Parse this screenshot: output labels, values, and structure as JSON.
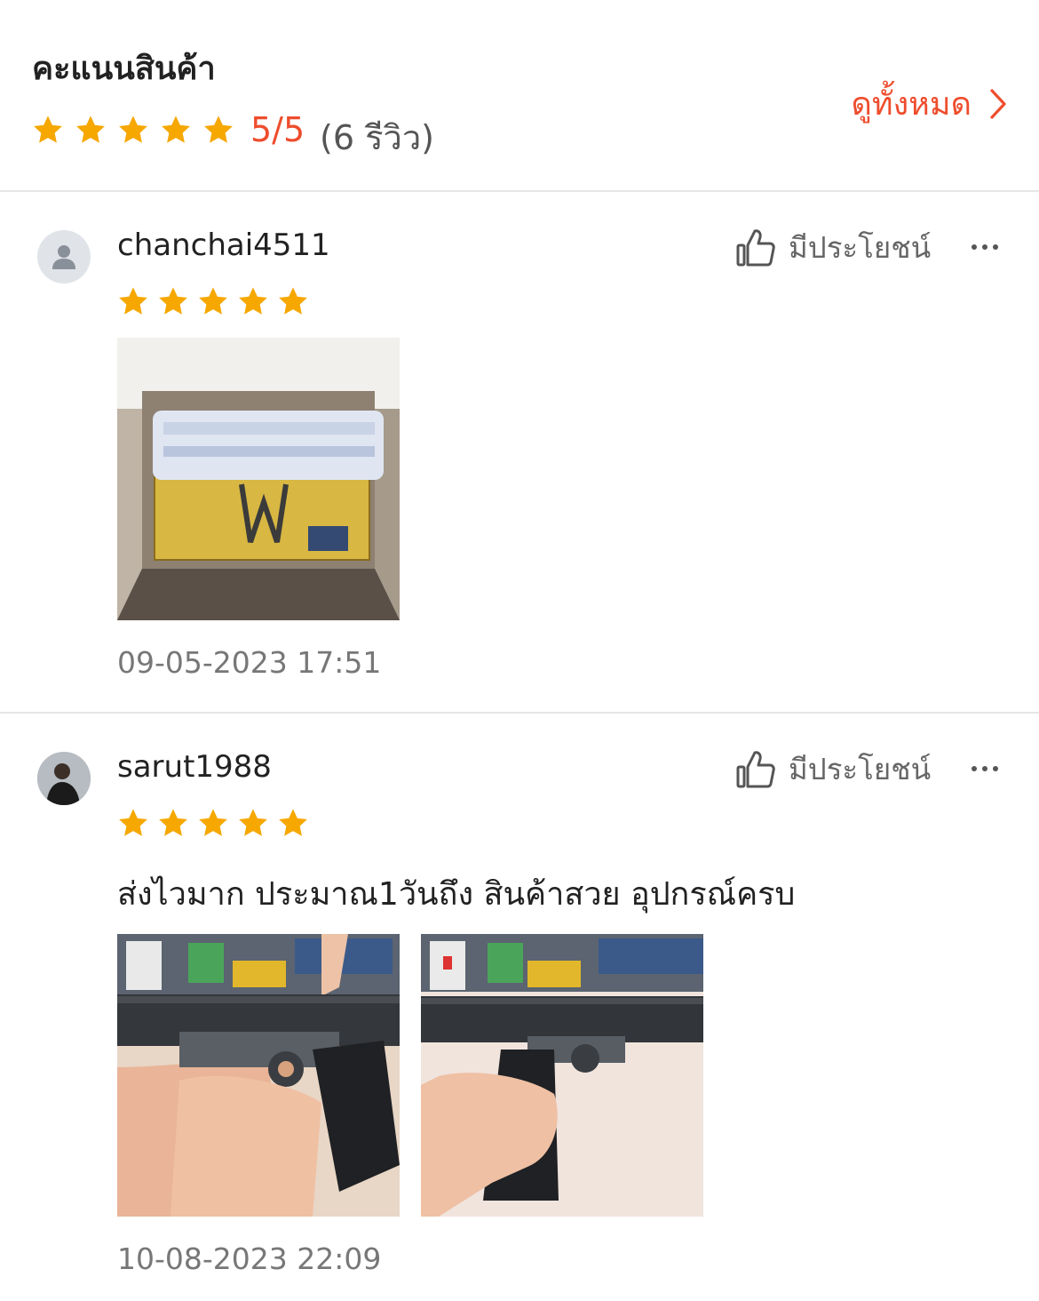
{
  "summary": {
    "title": "คะแนนสินค้า",
    "rating_stars": 5,
    "score": "5/5",
    "count": "(6 รีวิว)",
    "see_all": "ดูทั้งหมด"
  },
  "reviews": [
    {
      "username": "chanchai4511",
      "stars": 5,
      "helpful_label": "มีประโยชน์",
      "text": "",
      "timestamp": "09-05-2023 17:51",
      "photo_count": 1
    },
    {
      "username": "sarut1988",
      "stars": 5,
      "helpful_label": "มีประโยชน์",
      "text": "ส่งไวมาก ประมาณ1วันถึง สินค้าสวย อุปกรณ์ครบ",
      "timestamp": "10-08-2023 22:09",
      "photo_count": 2
    }
  ],
  "colors": {
    "accent": "#ee4d2d",
    "star": "#f6a700",
    "divider": "#e6e6e6"
  }
}
